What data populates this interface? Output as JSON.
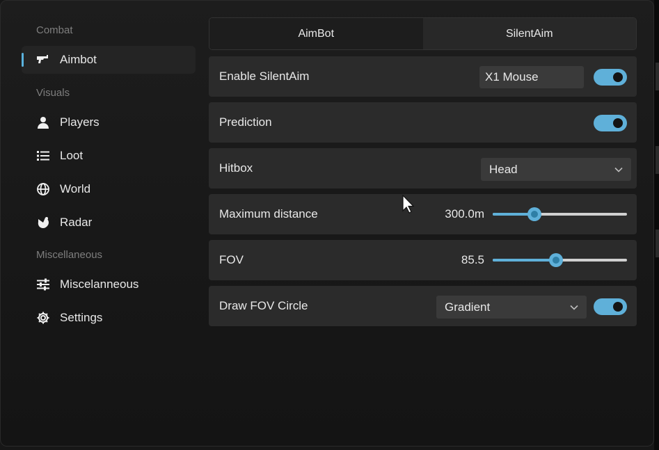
{
  "sidebar": {
    "sections": [
      "Combat",
      "Visuals",
      "Miscellaneous"
    ],
    "items": [
      {
        "label": "Aimbot",
        "icon": "gun-icon",
        "active": true
      },
      {
        "label": "Players",
        "icon": "person-icon"
      },
      {
        "label": "Loot",
        "icon": "list-icon"
      },
      {
        "label": "World",
        "icon": "globe-icon"
      },
      {
        "label": "Radar",
        "icon": "radar-icon"
      },
      {
        "label": "Miscelanneous",
        "icon": "sliders-icon"
      },
      {
        "label": "Settings",
        "icon": "gear-icon"
      }
    ]
  },
  "tabs": [
    {
      "label": "AimBot",
      "active": false
    },
    {
      "label": "SilentAim",
      "active": true
    }
  ],
  "settings": {
    "enable_silentaim": {
      "label": "Enable SilentAim",
      "keybind": "X1 Mouse",
      "enabled": true
    },
    "prediction": {
      "label": "Prediction",
      "enabled": true
    },
    "hitbox": {
      "label": "Hitbox",
      "value": "Head"
    },
    "max_distance": {
      "label": "Maximum distance",
      "value": "300.0m",
      "fraction": 0.31
    },
    "fov": {
      "label": "FOV",
      "value": "85.5",
      "fraction": 0.47
    },
    "draw_fov_circle": {
      "label": "Draw FOV Circle",
      "value": "Gradient",
      "enabled": true
    }
  },
  "colors": {
    "accent": "#5fb0d9",
    "row_bg": "#2b2b2b",
    "window_bg": "#1a1a1a"
  }
}
